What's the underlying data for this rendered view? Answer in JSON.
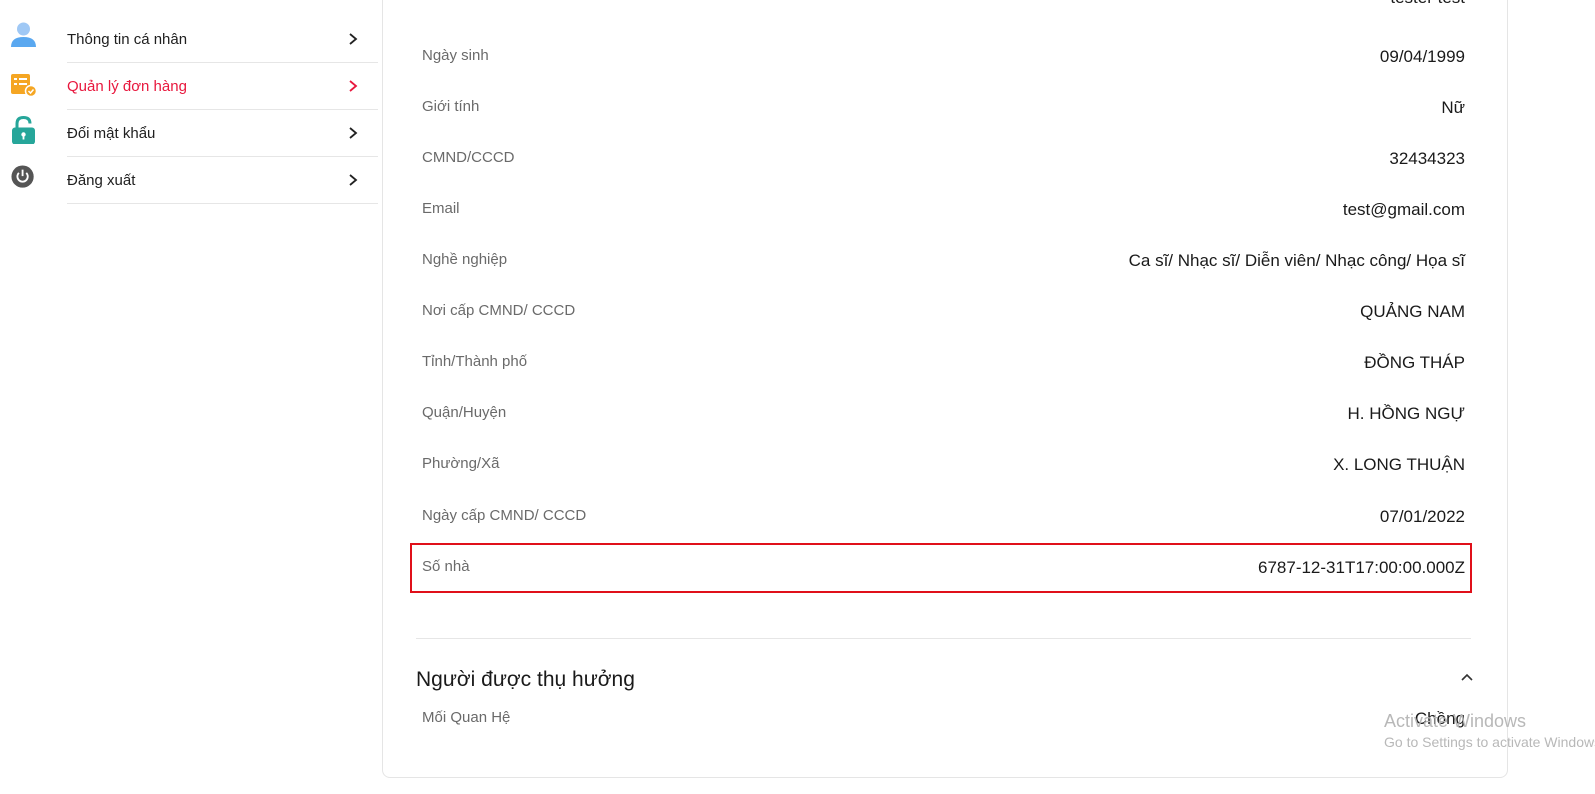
{
  "sidebar": {
    "items": [
      {
        "label": "Thông tin cá nhân",
        "icon": "user-icon"
      },
      {
        "label": "Quản lý đơn hàng",
        "icon": "order-icon",
        "active": true
      },
      {
        "label": "Đổi mật khẩu",
        "icon": "lock-icon"
      },
      {
        "label": "Đăng xuất",
        "icon": "power-icon"
      }
    ],
    "active_color": "#e8173d"
  },
  "profile": {
    "cut_off_value": "tester test",
    "rows": [
      {
        "label": "Ngày sinh",
        "value": "09/04/1999"
      },
      {
        "label": "Giới tính",
        "value": "Nữ"
      },
      {
        "label": "CMND/CCCD",
        "value": "32434323"
      },
      {
        "label": "Email",
        "value": "test@gmail.com"
      },
      {
        "label": "Nghề nghiệp",
        "value": "Ca sĩ/ Nhạc sĩ/ Diễn viên/ Nhạc công/ Họa sĩ"
      },
      {
        "label": "Nơi cấp CMND/ CCCD",
        "value": "QUẢNG NAM"
      },
      {
        "label": "Tỉnh/Thành phố",
        "value": "ĐỒNG THÁP"
      },
      {
        "label": "Quận/Huyện",
        "value": "H. HỒNG NGỰ"
      },
      {
        "label": "Phường/Xã",
        "value": "X. LONG THUẬN"
      },
      {
        "label": "Ngày cấp CMND/ CCCD",
        "value": "07/01/2022"
      },
      {
        "label": "Số nhà",
        "value": "6787-12-31T17:00:00.000Z"
      }
    ]
  },
  "beneficiary": {
    "title": "Người được thụ hưởng",
    "rows": [
      {
        "label": "Mối Quan Hệ",
        "value": "Chồng"
      }
    ]
  },
  "watermark": {
    "line1": "Activate Windows",
    "line2": "Go to Settings to activate Windows."
  },
  "colors": {
    "highlight_border": "#e0101a",
    "user_icon": "#5aa8f0",
    "order_icon": "#f5a623",
    "lock_icon": "#26a69a",
    "power_icon": "#555555"
  }
}
